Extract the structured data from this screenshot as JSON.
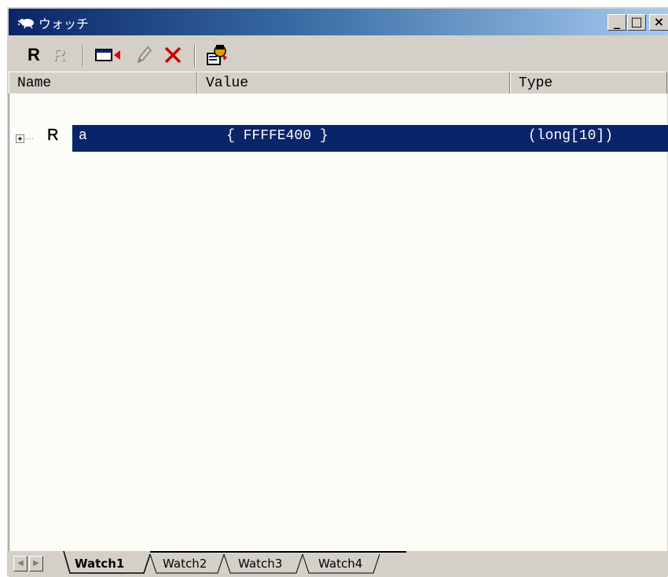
{
  "window": {
    "title": "ウォッチ",
    "minimize_label": "_",
    "maximize_label": "□",
    "close_label": "×"
  },
  "toolbar": {
    "items": [
      {
        "name": "radix-button",
        "label": "R"
      },
      {
        "name": "radix-disabled-button",
        "label": "R"
      },
      {
        "name": "add-watch-button",
        "icon": "watch-add-icon"
      },
      {
        "name": "edit-value-button",
        "icon": "pencil-icon"
      },
      {
        "name": "delete-button",
        "icon": "delete-x-icon"
      },
      {
        "name": "settings-button",
        "icon": "properties-icon"
      }
    ]
  },
  "table": {
    "columns": [
      "Name",
      "Value",
      "Type"
    ],
    "rows": [
      {
        "expander": "+",
        "radix_icon": "R",
        "name": "a",
        "value": "{ FFFFE400 }",
        "type": "(long[10])"
      }
    ]
  },
  "tabs": [
    {
      "label": "Watch1",
      "active": true
    },
    {
      "label": "Watch2",
      "active": false
    },
    {
      "label": "Watch3",
      "active": false
    },
    {
      "label": "Watch4",
      "active": false
    }
  ],
  "colors": {
    "title_start": "#0a246a",
    "title_end": "#a6caf0",
    "selection": "#0a246a",
    "face": "#d4d0c8"
  }
}
